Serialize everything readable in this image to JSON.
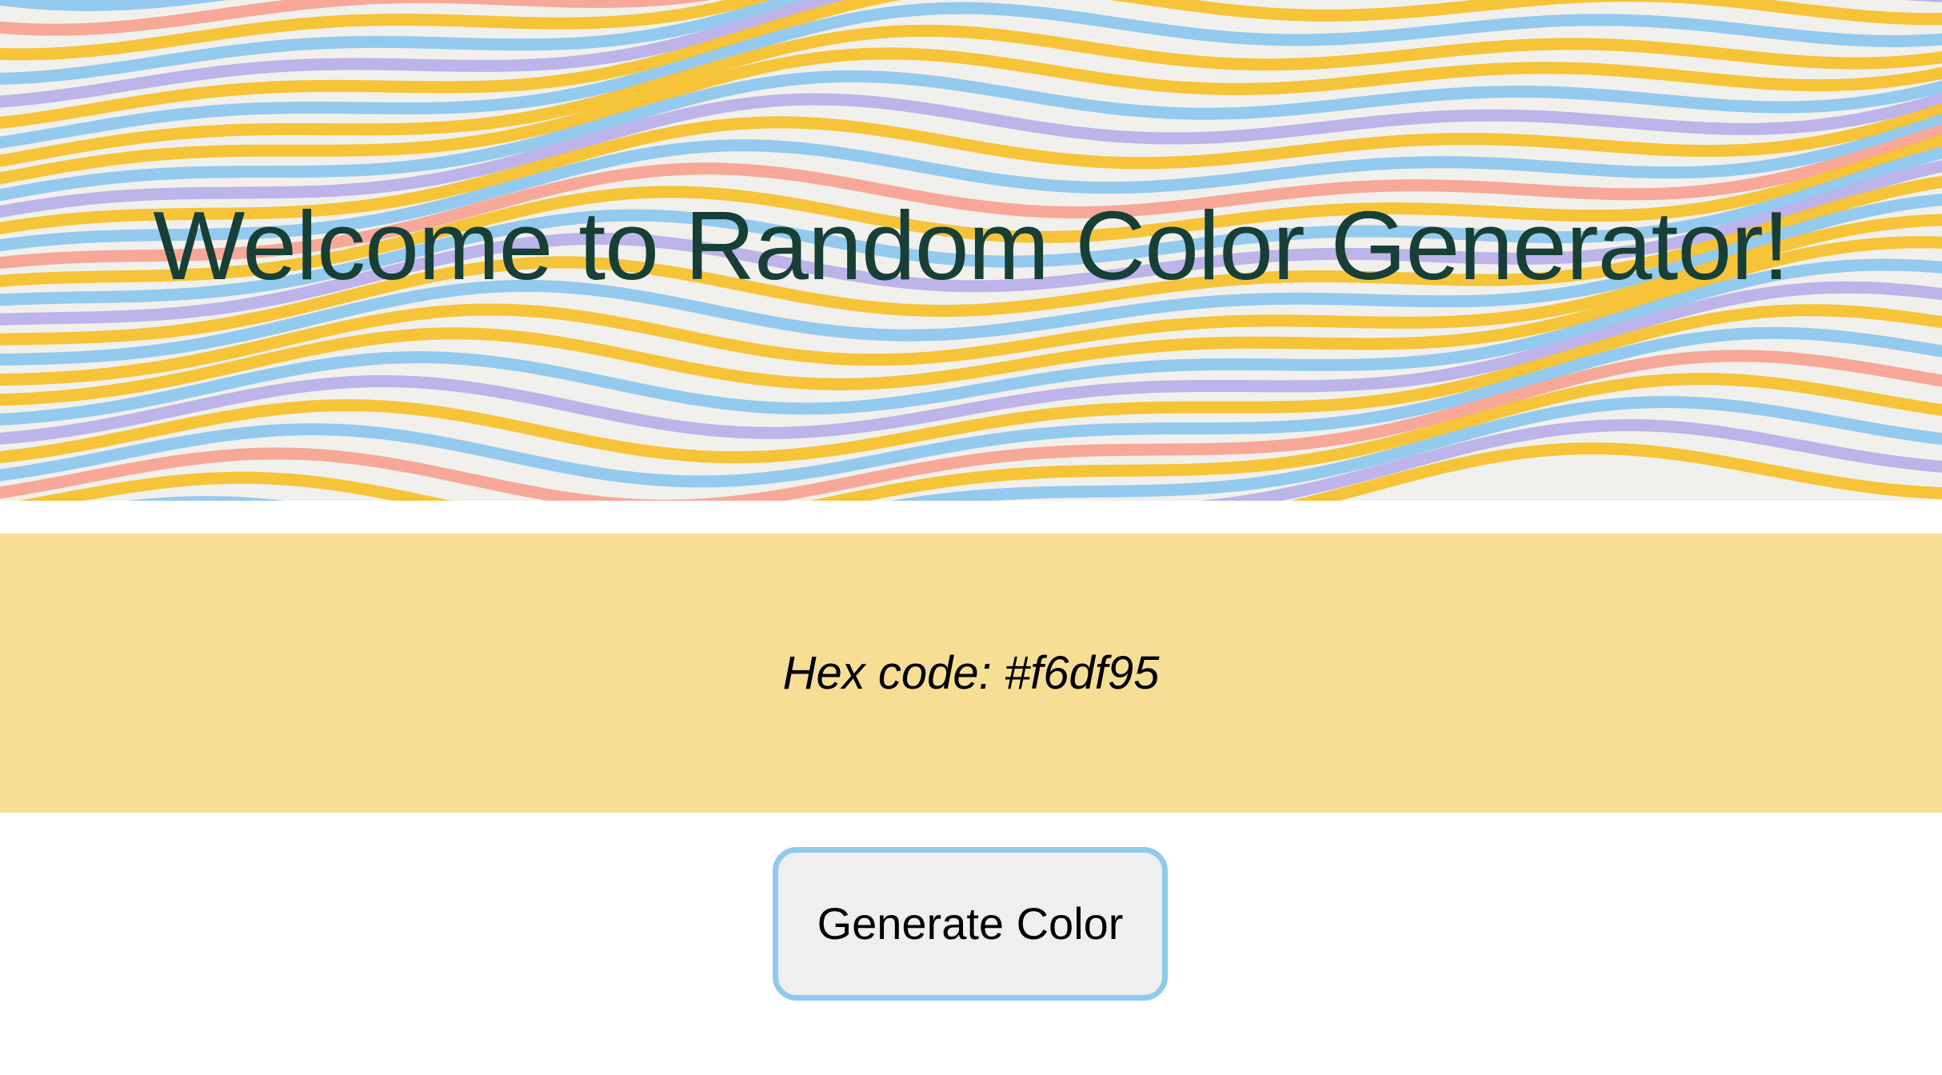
{
  "hero": {
    "title": "Welcome to Random Color Generator!",
    "background_image": "wavy-stripes-pattern",
    "stripe_colors": [
      "#f6c12f",
      "#8fc7ef",
      "#b9b0ea",
      "#f7a394"
    ],
    "title_color": "#173f36"
  },
  "color_display": {
    "hex_label": "Hex code: #f6df95",
    "current_color": "#f6df95"
  },
  "controls": {
    "generate_label": "Generate Color",
    "button_border_color": "#8ecbef"
  }
}
